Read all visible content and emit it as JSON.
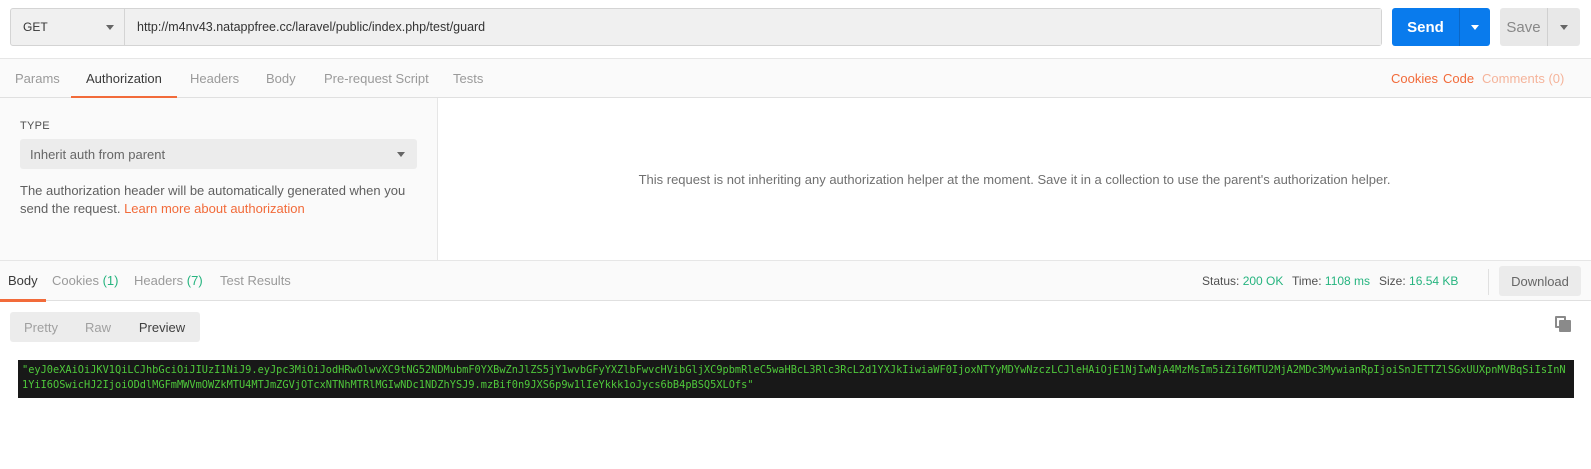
{
  "request": {
    "method": "GET",
    "url": "http://m4nv43.natappfree.cc/laravel/public/index.php/test/guard",
    "send_label": "Send",
    "save_label": "Save"
  },
  "request_tabs": [
    "Params",
    "Authorization",
    "Headers",
    "Body",
    "Pre-request Script",
    "Tests"
  ],
  "request_tabs_active": "Authorization",
  "request_links": {
    "cookies": "Cookies",
    "code": "Code",
    "comments": "Comments (0)"
  },
  "auth": {
    "type_label": "TYPE",
    "type_value": "Inherit auth from parent",
    "description": "The authorization header will be automatically generated when you send the request. ",
    "learn_more": "Learn more about authorization",
    "message": "This request is not inheriting any authorization helper at the moment. Save it in a collection to use the parent's authorization helper."
  },
  "response_tabs": {
    "body": "Body",
    "cookies": "Cookies",
    "cookies_count": "(1)",
    "headers": "Headers",
    "headers_count": "(7)",
    "test_results": "Test Results"
  },
  "response_meta": {
    "status_label": "Status:",
    "status_value": "200 OK",
    "time_label": "Time:",
    "time_value": "1108 ms",
    "size_label": "Size:",
    "size_value": "16.54 KB",
    "download_label": "Download"
  },
  "view_modes": {
    "pretty": "Pretty",
    "raw": "Raw",
    "preview": "Preview",
    "active": "Preview"
  },
  "response_body": "\"eyJ0eXAiOiJKV1QiLCJhbGciOiJIUzI1NiJ9.eyJpc3MiOiJodHRwOlwvXC9tNG52NDMubmF0YXBwZnJlZS5jY1wvbGFyYXZlbFwvcHVibGljXC9pbmRleC5waHBcL3Rlc3RcL2d1YXJkIiwiaWF0IjoxNTYyMDYwNzczLCJleHAiOjE1NjIwNjA4MzMsIm5iZiI6MTU2MjA2MDc3MywianRpIjoiSnJETTZlSGxUUXpnMVBqSiIsInN1YiI6OSwicHJ2IjoiODdlMGFmMWVmOWZkMTU4MTJmZGVjOTcxNTNhMTRlMGIwNDc1NDZhYSJ9.mzBif0n9JXS6p9w1lIeYkkk1oJycs6bB4pBSQ5XLOfs\""
}
